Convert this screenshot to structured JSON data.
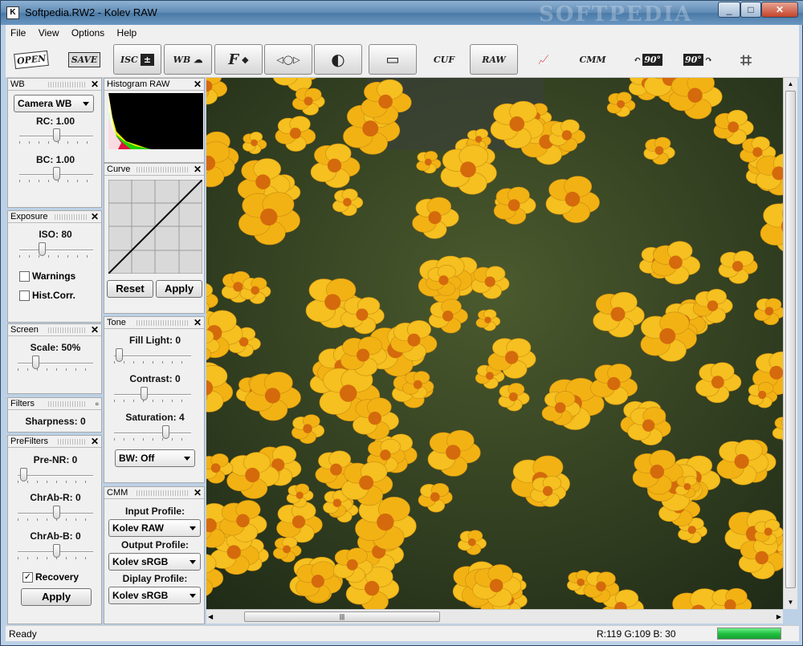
{
  "window": {
    "title": "Softpedia.RW2 - Kolev RAW",
    "watermark": "SOFTPEDIA",
    "controls": [
      "_",
      "□",
      "✕"
    ]
  },
  "menu": [
    "File",
    "View",
    "Options",
    "Help"
  ],
  "toolbar": {
    "open": "OPEN",
    "save": "SAVE",
    "isc": "ISC",
    "wb": "WB",
    "f": "F",
    "cuf": "CUF",
    "raw": "RAW",
    "cmm": "CMM",
    "rot": "90°"
  },
  "wb": {
    "title": "WB",
    "mode": "Camera WB",
    "rc": "RC: 1.00",
    "bc": "BC: 1.00",
    "rc_value": 1.0,
    "bc_value": 1.0
  },
  "exposure": {
    "title": "Exposure",
    "iso": "ISO: 80",
    "warnings": "Warnings",
    "histcorr": "Hist.Corr."
  },
  "screen": {
    "title": "Screen",
    "scale": "Scale: 50%"
  },
  "filters": {
    "title": "Filters",
    "sharpness": "Sharpness: 0"
  },
  "prefilters": {
    "title": "PreFilters",
    "prenr": "Pre-NR: 0",
    "chabr": "ChrAb-R: 0",
    "chabb": "ChrAb-B: 0",
    "recovery": "Recovery",
    "apply": "Apply"
  },
  "histogram": {
    "title": "Histogram RAW"
  },
  "curve": {
    "title": "Curve",
    "reset": "Reset",
    "apply": "Apply"
  },
  "tone": {
    "title": "Tone",
    "fill": "Fill Light: 0",
    "contrast": "Contrast: 0",
    "saturation": "Saturation: 4",
    "bw": "BW: Off"
  },
  "cmm": {
    "title": "CMM",
    "input_label": "Input Profile:",
    "input": "Kolev RAW",
    "output_label": "Output Profile:",
    "output": "Kolev sRGB",
    "display_label": "Diplay Profile:",
    "display": "Kolev sRGB"
  },
  "status": {
    "left": "Ready",
    "rgb": "R:119 G:109 B: 30"
  },
  "colors": {
    "accent": "#3f6a96",
    "status_green": "#22c040"
  }
}
